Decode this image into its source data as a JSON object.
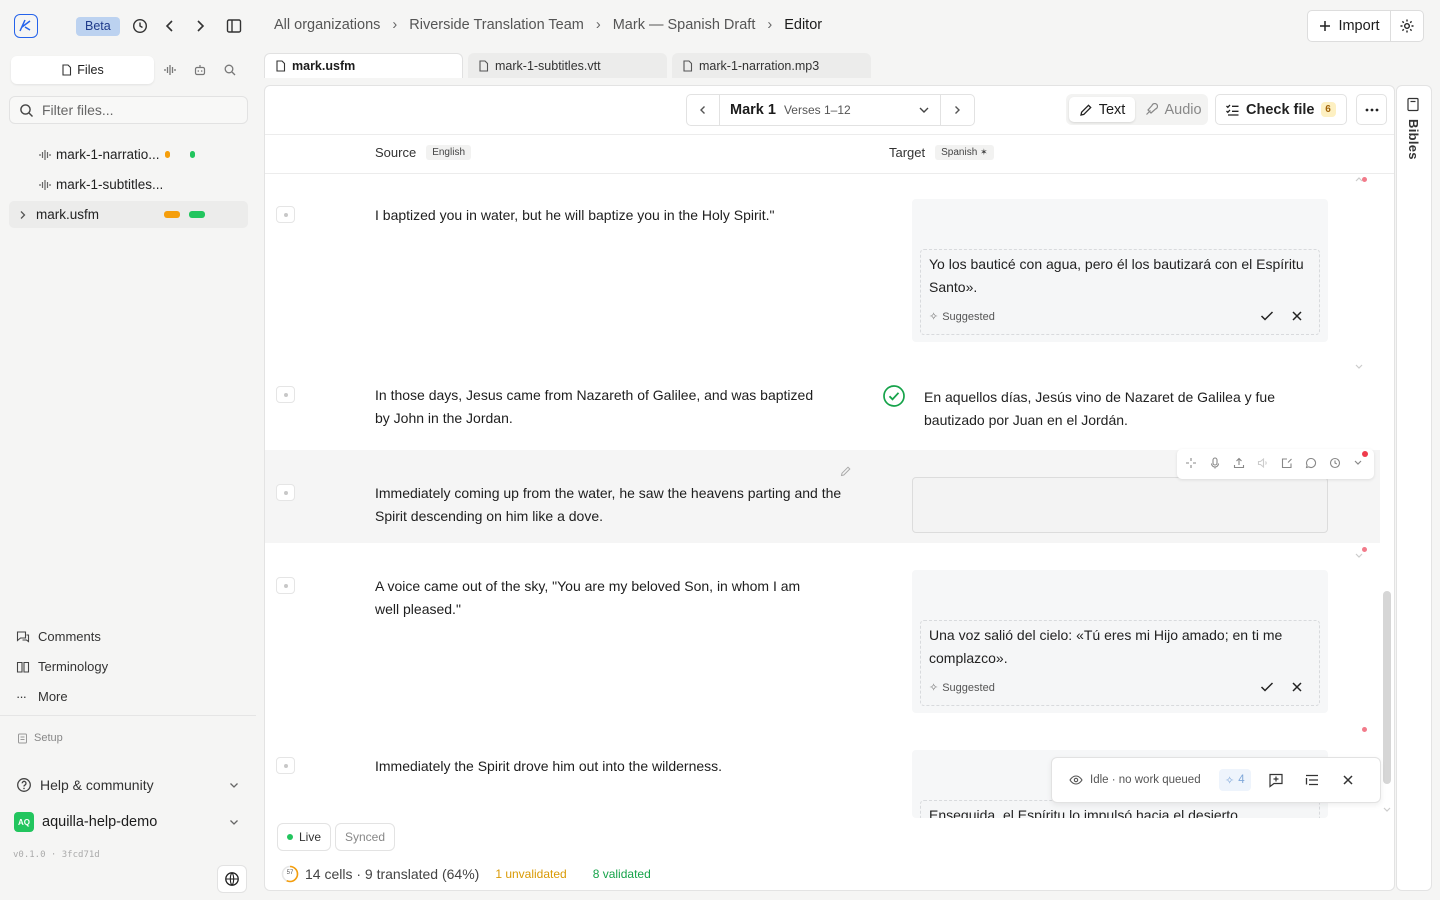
{
  "top": {
    "beta": "Beta",
    "crumbs": [
      "All organizations",
      "Riverside Translation Team",
      "Mark — Spanish Draft",
      "Editor"
    ],
    "import": "Import"
  },
  "sidebar": {
    "tab_files": "Files",
    "filter_placeholder": "Filter files...",
    "files": [
      {
        "name": "mark-1-narratio...",
        "icon": "waveform-icon"
      },
      {
        "name": "mark-1-subtitles...",
        "icon": "waveform-icon"
      },
      {
        "name": "mark.usfm",
        "icon": "chevron-right-icon"
      }
    ],
    "links": [
      "Comments",
      "Terminology",
      "More"
    ],
    "setup": "Setup",
    "help": "Help & community",
    "org_initials": "AQ",
    "org": "aquilla-help-demo",
    "version": "v0.1.0 · 3fcd71d"
  },
  "file_tabs": [
    "mark.usfm",
    "mark-1-subtitles.vtt",
    "mark-1-narration.mp3"
  ],
  "toolbar": {
    "book": "Mark 1",
    "verses": "Verses 1–12",
    "text_mode": "Text",
    "audio_mode": "Audio",
    "check_file": "Check file",
    "check_count": "6"
  },
  "columns": {
    "source": "Source",
    "source_lang": "English",
    "target": "Target",
    "target_lang": "Spanish"
  },
  "rows": [
    {
      "source": "I baptized you in water, but he will baptize you in the Holy Spirit.\"",
      "target": "Yo los bauticé con agua, pero él los bautizará con el Espíritu Santo».",
      "state": "suggested"
    },
    {
      "source": "In those days, Jesus came from Nazareth of Galilee, and was baptized by John in the Jordan.",
      "target": "En aquellos días, Jesús vino de Nazaret de Galilea y fue bautizado por Juan en el Jordán.",
      "state": "validated"
    },
    {
      "source": "Immediately coming up from the water, he saw the heavens parting and the Spirit descending on him like a dove.",
      "target": "",
      "state": "editing"
    },
    {
      "source": "A voice came out of the sky, \"You are my beloved Son, in whom I am well pleased.\"",
      "target": "Una voz salió del cielo: «Tú eres mi Hijo amado; en ti me complazco».",
      "state": "suggested"
    },
    {
      "source": "Immediately the Spirit drove him out into the wilderness.",
      "target": "Enseguida, el Espíritu lo impulsó hacia el desierto.",
      "state": "suggested"
    }
  ],
  "suggested_label": "Suggested",
  "status": {
    "text": "Idle · no work queued",
    "count": "4"
  },
  "pills": {
    "live": "Live",
    "synced": "Synced"
  },
  "footer": {
    "progress": "57",
    "summary": "14 cells · 9 translated (64%)",
    "unvalidated": "1 unvalidated",
    "validated": "8 validated"
  },
  "right_panel": {
    "label": "Bibles"
  },
  "colors": {
    "accent": "#2563eb",
    "validated": "#16a34a",
    "unvalidated": "#d99a06",
    "orange": "#f59e0b",
    "green": "#22c55e"
  }
}
